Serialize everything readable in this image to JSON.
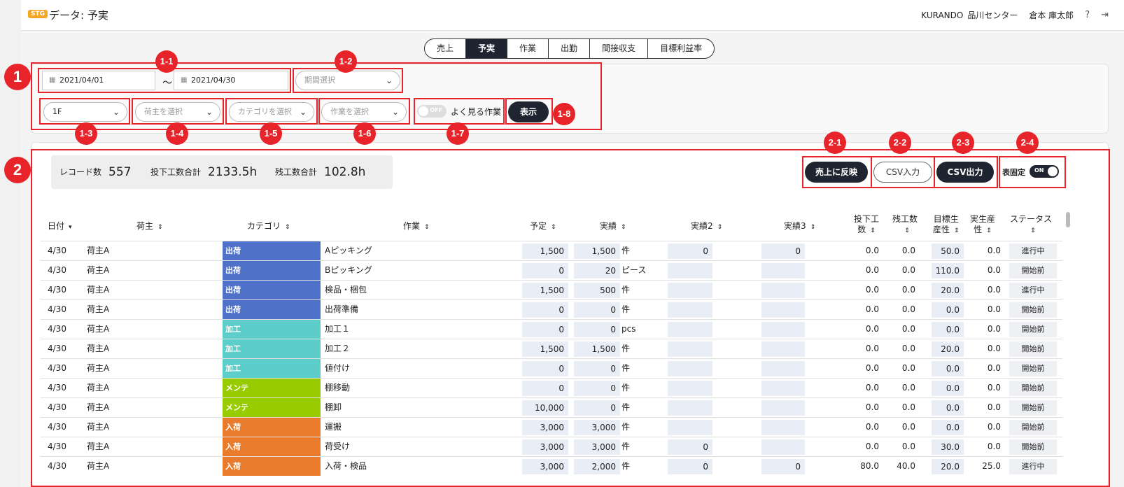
{
  "header": {
    "env_badge": "STG",
    "title": "データ: 予実",
    "company": "KURANDO",
    "center": "品川センター",
    "user": "倉本 庫太郎",
    "help_icon": "?",
    "logout_icon": "⇥"
  },
  "tabs": [
    "売上",
    "予実",
    "作業",
    "出勤",
    "間接収支",
    "目標利益率"
  ],
  "active_tab": "予実",
  "filters": {
    "date_from": "2021/04/01",
    "date_sep": "～",
    "date_to": "2021/04/30",
    "period_placeholder": "期間選択",
    "floor": "1F",
    "shipper_placeholder": "荷主を選択",
    "category_placeholder": "カテゴリを選択",
    "task_placeholder": "作業を選択",
    "toggle_state": "OFF",
    "toggle_label": "よく見る作業",
    "show_button": "表示"
  },
  "annotations": {
    "a1": "1",
    "a1_1": "1-1",
    "a1_2": "1-2",
    "a1_3": "1-3",
    "a1_4": "1-4",
    "a1_5": "1-5",
    "a1_6": "1-6",
    "a1_7": "1-7",
    "a1_8": "1-8",
    "a2": "2",
    "a2_1": "2-1",
    "a2_2": "2-2",
    "a2_3": "2-3",
    "a2_4": "2-4"
  },
  "summary": {
    "records_label": "レコード数",
    "records": "557",
    "hours_label": "投下工数合計",
    "hours": "2133.5h",
    "remain_label": "残工数合計",
    "remain": "102.8h"
  },
  "actions": {
    "reflect": "売上に反映",
    "csv_in": "CSV入力",
    "csv_out": "CSV出力",
    "fix_label": "表固定",
    "fix_state": "ON"
  },
  "columns": {
    "date": "日付",
    "shipper": "荷主",
    "category": "カテゴリ",
    "task": "作業",
    "plan": "予定",
    "actual": "実績",
    "actual2": "実績2",
    "actual3": "実績3",
    "input_hours_1": "投下工",
    "input_hours_2": "数",
    "remain_1": "残工数",
    "target_1": "目標生",
    "target_2": "産性",
    "real_1": "実生産",
    "real_2": "性",
    "status": "ステータス"
  },
  "colors": {
    "出荷": "#4f71c8",
    "加工": "#5ccdc9",
    "メンテ": "#99cc00",
    "入荷": "#e87c2c",
    "accent_red": "#e8242b",
    "dark": "#1f2530"
  },
  "rows": [
    {
      "date": "4/30",
      "shipper": "荷主A",
      "category": "出荷",
      "task": "Aピッキング",
      "plan": "1,500",
      "actual": "1,500",
      "unit": "件",
      "a2": "0",
      "a3": "0",
      "input": "0.0",
      "remain": "0.0",
      "target": "50.0",
      "real": "0.0",
      "status": "進行中"
    },
    {
      "date": "4/30",
      "shipper": "荷主A",
      "category": "出荷",
      "task": "Bピッキング",
      "plan": "0",
      "actual": "20",
      "unit": "ピース",
      "a2": "",
      "a3": "",
      "input": "0.0",
      "remain": "0.0",
      "target": "110.0",
      "real": "0.0",
      "status": "開始前"
    },
    {
      "date": "4/30",
      "shipper": "荷主A",
      "category": "出荷",
      "task": "検品・梱包",
      "plan": "1,500",
      "actual": "500",
      "unit": "件",
      "a2": "",
      "a3": "",
      "input": "0.0",
      "remain": "0.0",
      "target": "20.0",
      "real": "0.0",
      "status": "進行中"
    },
    {
      "date": "4/30",
      "shipper": "荷主A",
      "category": "出荷",
      "task": "出荷準備",
      "plan": "0",
      "actual": "0",
      "unit": "件",
      "a2": "",
      "a3": "",
      "input": "0.0",
      "remain": "0.0",
      "target": "0.0",
      "real": "0.0",
      "status": "開始前"
    },
    {
      "date": "4/30",
      "shipper": "荷主A",
      "category": "加工",
      "task": "加工１",
      "plan": "0",
      "actual": "0",
      "unit": "pcs",
      "a2": "",
      "a3": "",
      "input": "0.0",
      "remain": "0.0",
      "target": "0.0",
      "real": "0.0",
      "status": "開始前"
    },
    {
      "date": "4/30",
      "shipper": "荷主A",
      "category": "加工",
      "task": "加工２",
      "plan": "1,500",
      "actual": "1,500",
      "unit": "件",
      "a2": "",
      "a3": "",
      "input": "0.0",
      "remain": "0.0",
      "target": "20.0",
      "real": "0.0",
      "status": "開始前"
    },
    {
      "date": "4/30",
      "shipper": "荷主A",
      "category": "加工",
      "task": "値付け",
      "plan": "0",
      "actual": "0",
      "unit": "件",
      "a2": "",
      "a3": "",
      "input": "0.0",
      "remain": "0.0",
      "target": "0.0",
      "real": "0.0",
      "status": "開始前"
    },
    {
      "date": "4/30",
      "shipper": "荷主A",
      "category": "メンテ",
      "task": "棚移動",
      "plan": "0",
      "actual": "0",
      "unit": "件",
      "a2": "",
      "a3": "",
      "input": "0.0",
      "remain": "0.0",
      "target": "0.0",
      "real": "0.0",
      "status": "開始前"
    },
    {
      "date": "4/30",
      "shipper": "荷主A",
      "category": "メンテ",
      "task": "棚卸",
      "plan": "10,000",
      "actual": "0",
      "unit": "件",
      "a2": "",
      "a3": "",
      "input": "0.0",
      "remain": "0.0",
      "target": "0.0",
      "real": "0.0",
      "status": "開始前"
    },
    {
      "date": "4/30",
      "shipper": "荷主A",
      "category": "入荷",
      "task": "運搬",
      "plan": "3,000",
      "actual": "3,000",
      "unit": "件",
      "a2": "",
      "a3": "",
      "input": "0.0",
      "remain": "0.0",
      "target": "0.0",
      "real": "0.0",
      "status": "開始前"
    },
    {
      "date": "4/30",
      "shipper": "荷主A",
      "category": "入荷",
      "task": "荷受け",
      "plan": "3,000",
      "actual": "3,000",
      "unit": "件",
      "a2": "0",
      "a3": "",
      "input": "0.0",
      "remain": "0.0",
      "target": "30.0",
      "real": "0.0",
      "status": "開始前"
    },
    {
      "date": "4/30",
      "shipper": "荷主A",
      "category": "入荷",
      "task": "入荷・検品",
      "plan": "3,000",
      "actual": "2,000",
      "unit": "件",
      "a2": "0",
      "a3": "0",
      "input": "80.0",
      "remain": "40.0",
      "target": "20.0",
      "real": "25.0",
      "status": "進行中"
    }
  ]
}
